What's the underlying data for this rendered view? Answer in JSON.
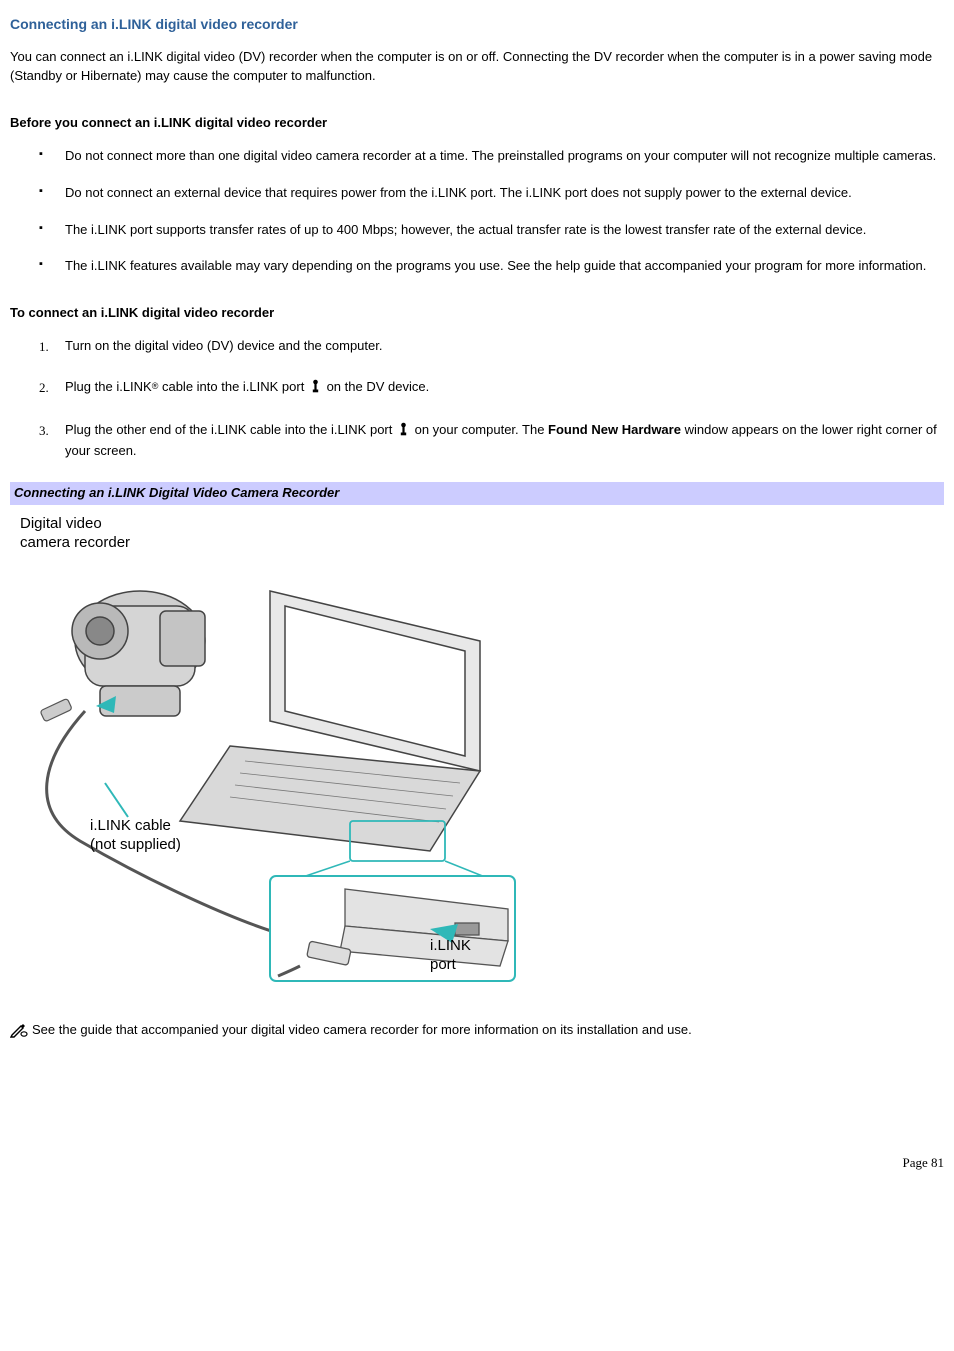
{
  "title": "Connecting an i.LINK digital video recorder",
  "intro": "You can connect an i.LINK digital video (DV) recorder when the computer is on or off. Connecting the DV recorder when the computer is in a power saving mode (Standby or Hibernate) may cause the computer to malfunction.",
  "before_heading": "Before you connect an i.LINK digital video recorder",
  "before_items": [
    "Do not connect more than one digital video camera recorder at a time. The preinstalled programs on your computer will not recognize multiple cameras.",
    "Do not connect an external device that requires power from the i.LINK port. The i.LINK port does not supply power to the external device.",
    "The i.LINK port supports transfer rates of up to 400 Mbps; however, the actual transfer rate is the lowest transfer rate of the external device.",
    "The i.LINK features available may vary depending on the programs you use. See the help guide that accompanied your program for more information."
  ],
  "connect_heading": "To connect an i.LINK digital video recorder",
  "steps": {
    "s1": "Turn on the digital video (DV) device and the computer.",
    "s2_a": "Plug the i.LINK",
    "s2_b": " cable into the i.LINK port ",
    "s2_c": " on the DV device.",
    "s3_a": "Plug the other end of the i.LINK cable into the i.LINK port ",
    "s3_b": " on your computer. The ",
    "s3_bold": "Found New Hardware",
    "s3_c": " window appears on the lower right corner of your screen."
  },
  "regmark": "®",
  "figure_caption": "Connecting an i.LINK Digital Video Camera Recorder",
  "figure_labels": {
    "camera": "Digital video\ncamera recorder",
    "cable_a": "i.LINK cable",
    "cable_b": "(not supplied)",
    "port_a": "i.LINK",
    "port_b": "port"
  },
  "note_text": "See the guide that accompanied your digital video camera recorder for more information on its installation and use.",
  "page_label": "Page 81"
}
